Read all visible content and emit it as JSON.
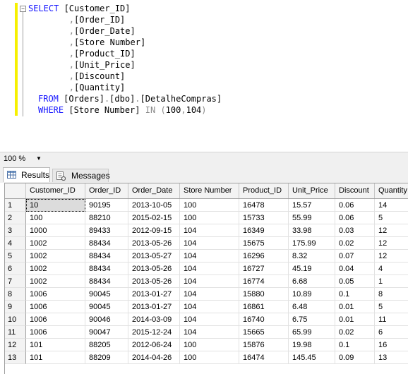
{
  "editor": {
    "lines": [
      {
        "kw": "SELECT ",
        "pre": "",
        "comma": "",
        "text": "[Customer_ID]"
      },
      {
        "kw": "",
        "pre": "        ",
        "comma": ",",
        "text": "[Order_ID]"
      },
      {
        "kw": "",
        "pre": "        ",
        "comma": ",",
        "text": "[Order_Date]"
      },
      {
        "kw": "",
        "pre": "        ",
        "comma": ",",
        "text": "[Store Number]"
      },
      {
        "kw": "",
        "pre": "        ",
        "comma": ",",
        "text": "[Product_ID]"
      },
      {
        "kw": "",
        "pre": "        ",
        "comma": ",",
        "text": "[Unit_Price]"
      },
      {
        "kw": "",
        "pre": "        ",
        "comma": ",",
        "text": "[Discount]"
      },
      {
        "kw": "",
        "pre": "        ",
        "comma": ",",
        "text": "[Quantity]"
      }
    ],
    "from_kw": "FROM",
    "from_obj": "[Orders]",
    "dot": ".",
    "from_schema": "[dbo]",
    "from_table": "[DetalheCompras]",
    "where_kw": "WHERE",
    "where_col": "[Store Number]",
    "in_kw": "IN",
    "in_open": "(",
    "in_v1": "100",
    "in_comma": ",",
    "in_v2": "104",
    "in_close": ")",
    "marker_color": "#f6f000",
    "keyword_color": "#1515ff"
  },
  "zoom": {
    "value": "100 %",
    "dropdown_icon": "chevron-down-icon"
  },
  "tabs": [
    {
      "label": "Results",
      "icon": "grid-icon",
      "active": true
    },
    {
      "label": "Messages",
      "icon": "messages-icon",
      "active": false
    }
  ],
  "grid": {
    "columns": [
      "",
      "Customer_ID",
      "Order_ID",
      "Order_Date",
      "Store Number",
      "Product_ID",
      "Unit_Price",
      "Discount",
      "Quantity"
    ],
    "rows": [
      [
        "1",
        "10",
        "90195",
        "2013-10-05",
        "100",
        "16478",
        "15.57",
        "0.06",
        "14"
      ],
      [
        "2",
        "100",
        "88210",
        "2015-02-15",
        "100",
        "15733",
        "55.99",
        "0.06",
        "5"
      ],
      [
        "3",
        "1000",
        "89433",
        "2012-09-15",
        "104",
        "16349",
        "33.98",
        "0.03",
        "12"
      ],
      [
        "4",
        "1002",
        "88434",
        "2013-05-26",
        "104",
        "15675",
        "175.99",
        "0.02",
        "12"
      ],
      [
        "5",
        "1002",
        "88434",
        "2013-05-27",
        "104",
        "16296",
        "8.32",
        "0.07",
        "12"
      ],
      [
        "6",
        "1002",
        "88434",
        "2013-05-26",
        "104",
        "16727",
        "45.19",
        "0.04",
        "4"
      ],
      [
        "7",
        "1002",
        "88434",
        "2013-05-26",
        "104",
        "16774",
        "6.68",
        "0.05",
        "1"
      ],
      [
        "8",
        "1006",
        "90045",
        "2013-01-27",
        "104",
        "15880",
        "10.89",
        "0.1",
        "8"
      ],
      [
        "9",
        "1006",
        "90045",
        "2013-01-27",
        "104",
        "16861",
        "6.48",
        "0.01",
        "5"
      ],
      [
        "10",
        "1006",
        "90046",
        "2014-03-09",
        "104",
        "16740",
        "6.75",
        "0.01",
        "11"
      ],
      [
        "11",
        "1006",
        "90047",
        "2015-12-24",
        "104",
        "15665",
        "65.99",
        "0.02",
        "6"
      ],
      [
        "12",
        "101",
        "88205",
        "2012-06-24",
        "100",
        "15876",
        "19.98",
        "0.1",
        "16"
      ],
      [
        "13",
        "101",
        "88209",
        "2014-04-26",
        "100",
        "16474",
        "145.45",
        "0.09",
        "13"
      ]
    ]
  }
}
